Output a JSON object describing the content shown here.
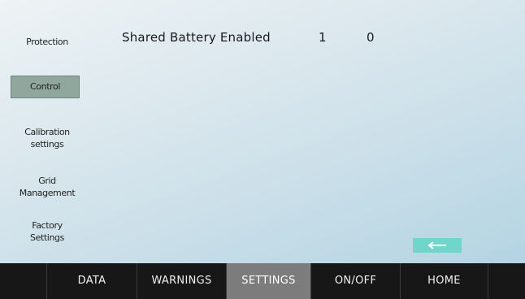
{
  "sidebar": {
    "items": [
      {
        "label": "Protection"
      },
      {
        "label": "Control"
      },
      {
        "label_line1": "Calibration",
        "label_line2": "settings"
      },
      {
        "label_line1": "Grid",
        "label_line2": "Management"
      },
      {
        "label_line1": "Factory",
        "label_line2": "Settings"
      }
    ]
  },
  "main": {
    "setting": {
      "label": "Shared Battery Enabled",
      "option_1": "1",
      "option_2": "0"
    },
    "back_button_icon": "left-arrow-icon"
  },
  "bottom_nav": {
    "items": [
      "DATA",
      "WARNINGS",
      "SETTINGS",
      "ON/OFF",
      "HOME"
    ],
    "active": "SETTINGS"
  },
  "colors": {
    "active_sidebar": "#8fa79c",
    "back_button": "#6fd6cc",
    "nav_bar": "#171717",
    "nav_active": "#7c7c7c"
  }
}
